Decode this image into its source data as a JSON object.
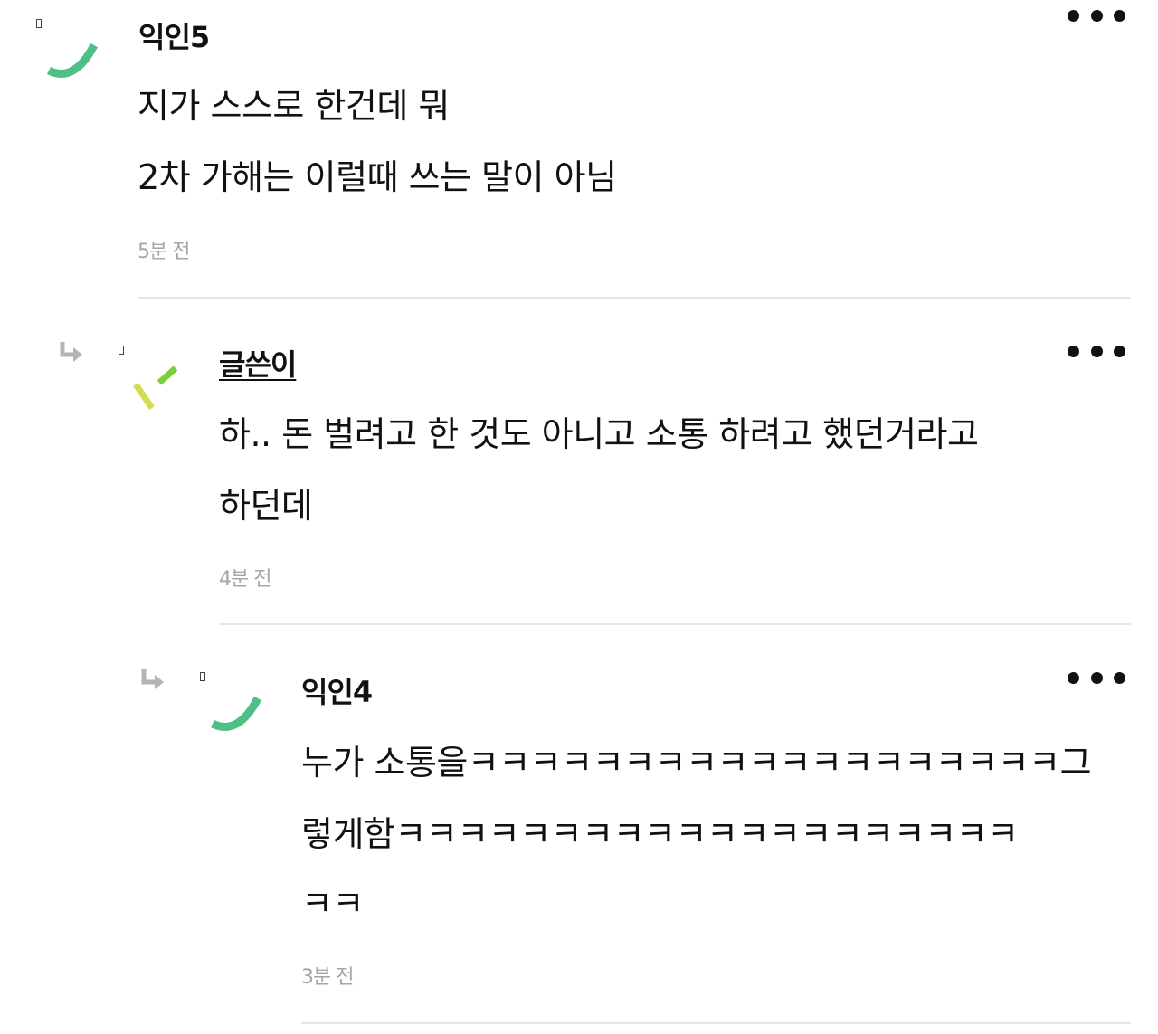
{
  "comments": [
    {
      "author": "익인5",
      "is_reply": false,
      "is_op": false,
      "lines": [
        "지가 스스로 한건데 뭐",
        "2차 가해는 이럴때 쓰는 말이 아님"
      ],
      "time": "5분 전",
      "avatar_icon": "green-arc-avatar-icon",
      "avatar_colors": [
        "#4fbf86"
      ]
    },
    {
      "author": "글쓴이",
      "is_reply": true,
      "is_op": true,
      "lines": [
        "하.. 돈 벌려고 한 것도 아니고 소통 하려고 했던거라고",
        "하던데"
      ],
      "time": "4분 전",
      "avatar_icon": "yellow-green-slash-avatar-icon",
      "avatar_colors": [
        "#d6dc52",
        "#7ccf3c"
      ]
    },
    {
      "author": "익인4",
      "is_reply": true,
      "is_op": false,
      "lines": [
        "누가 소통을ㅋㅋㅋㅋㅋㅋㅋㅋㅋㅋㅋㅋㅋㅋㅋㅋㅋㅋㅋ그",
        "렇게함ㅋㅋㅋㅋㅋㅋㅋㅋㅋㅋㅋㅋㅋㅋㅋㅋㅋㅋㅋㅋ",
        "ㅋㅋ"
      ],
      "time": "3분 전",
      "avatar_icon": "green-arc-avatar-icon",
      "avatar_colors": [
        "#4fbf86"
      ]
    }
  ],
  "icons": {
    "more": "more-options-icon",
    "reply": "reply-arrow-icon"
  }
}
